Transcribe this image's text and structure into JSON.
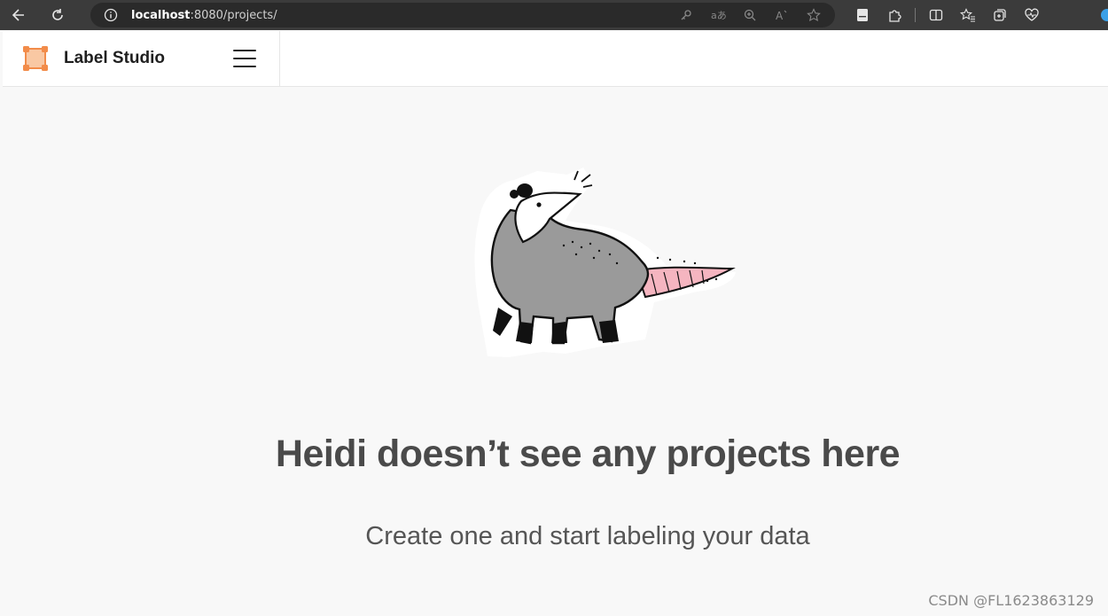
{
  "browser": {
    "url_host": "localhost",
    "url_rest": ":8080/projects/"
  },
  "app": {
    "title": "Label Studio",
    "brand_color": "#f59a5b"
  },
  "empty_state": {
    "title": "Heidi doesn’t see any projects here",
    "subtitle": "Create one and start labeling your data"
  },
  "watermark": "CSDN @FL1623863129",
  "icons": [
    "back-icon",
    "reload-icon",
    "info-icon",
    "key-icon",
    "translate-icon",
    "zoom-icon",
    "read-aloud-icon",
    "favorite-star-icon",
    "page-icon",
    "extensions-icon",
    "split-screen-icon",
    "favorites-icon",
    "collections-icon",
    "health-icon",
    "menu-icon",
    "opossum-illustration"
  ]
}
